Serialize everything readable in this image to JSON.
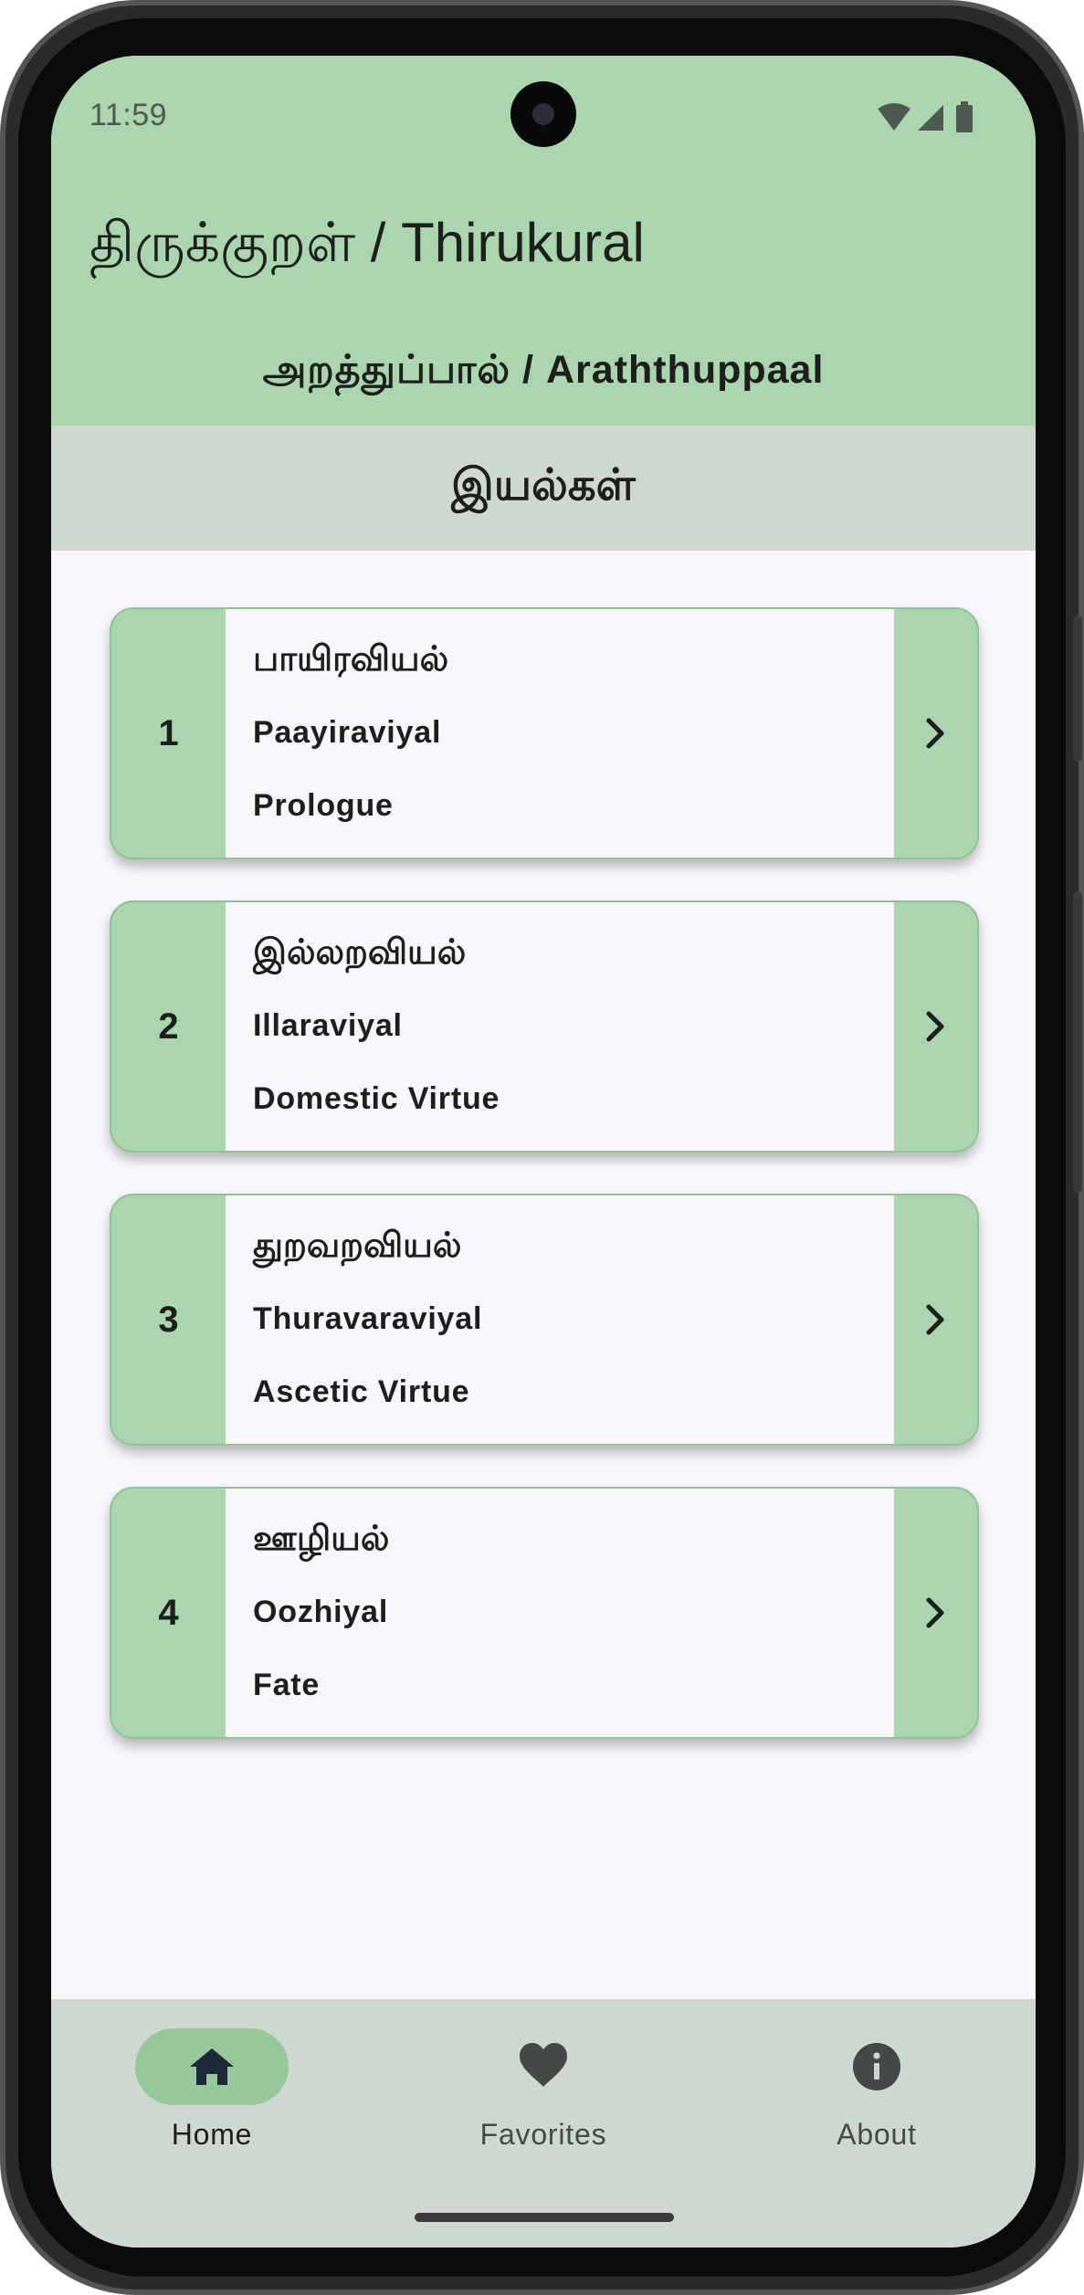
{
  "status_bar": {
    "time": "11:59",
    "icons": [
      "wifi-icon",
      "signal-icon",
      "battery-icon"
    ]
  },
  "header": {
    "title": "திருக்குறள் / Thirukural",
    "subtitle": "அறத்துப்பால் / Araththuppaal"
  },
  "section": {
    "title": "இயல்கள்"
  },
  "chapters": [
    {
      "number": "1",
      "tamil": "பாயிரவியல்",
      "transliteration": "Paayiraviyal",
      "english": "Prologue"
    },
    {
      "number": "2",
      "tamil": "இல்லறவியல்",
      "transliteration": "Illaraviyal",
      "english": "Domestic Virtue"
    },
    {
      "number": "3",
      "tamil": "துறவறவியல்",
      "transliteration": "Thuravaraviyal",
      "english": "Ascetic Virtue"
    },
    {
      "number": "4",
      "tamil": "ஊழியல்",
      "transliteration": "Oozhiyal",
      "english": "Fate"
    }
  ],
  "bottom_nav": {
    "items": [
      {
        "label": "Home",
        "icon": "home-icon",
        "selected": true
      },
      {
        "label": "Favorites",
        "icon": "heart-icon",
        "selected": false
      },
      {
        "label": "About",
        "icon": "info-icon",
        "selected": false
      }
    ]
  },
  "colors": {
    "app_bar": "#abd5ae",
    "section_header": "#cfd8d0",
    "card_accent": "#abd5ae",
    "card_body": "#f8f6fb",
    "nav_pill": "#99c79c",
    "nav_icon_selected": "#1d2a3a",
    "nav_icon_unselected": "#434a46"
  }
}
